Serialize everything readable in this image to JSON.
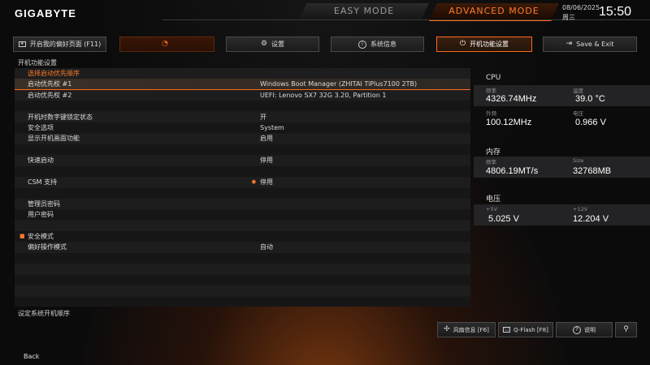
{
  "header": {
    "logo": "GIGABYTE",
    "easy_mode": "EASY MODE",
    "advanced_mode": "ADVANCED MODE",
    "date": "08/06/2025",
    "weekday": "周三",
    "time": "15:50"
  },
  "nav": [
    {
      "label": "开启我的偏好页面 (F11)",
      "icon": "favorites-icon"
    },
    {
      "label": "",
      "icon": "gauge-icon"
    },
    {
      "label": "设置",
      "icon": "gear-icon"
    },
    {
      "label": "系统信息",
      "icon": "info-icon"
    },
    {
      "label": "开机功能设置",
      "icon": "power-icon"
    },
    {
      "label": "Save & Exit",
      "icon": "exit-icon"
    }
  ],
  "section_title": "开机功能设置",
  "settings": [
    {
      "label": "选择启动优先顺序",
      "value": "",
      "type": "group"
    },
    {
      "label": "启动优先权 #1",
      "value": "Windows Boot Manager (ZHITAI TiPlus7100 2TB)",
      "type": "selected"
    },
    {
      "label": "启动优先权 #2",
      "value": "UEFI: Lenovo SX7 32G 3.20, Partition 1",
      "type": "item"
    },
    {
      "label": "",
      "value": "",
      "type": "blank"
    },
    {
      "label": "开机时数字键锁定状态",
      "value": "开",
      "type": "item"
    },
    {
      "label": "安全选项",
      "value": "System",
      "type": "item"
    },
    {
      "label": "显示开机画面功能",
      "value": "启用",
      "type": "item"
    },
    {
      "label": "",
      "value": "",
      "type": "blank"
    },
    {
      "label": "快速启动",
      "value": "停用",
      "type": "item"
    },
    {
      "label": "",
      "value": "",
      "type": "blank"
    },
    {
      "label": "CSM 支持",
      "value": "停用",
      "type": "item",
      "value_bullet": true
    },
    {
      "label": "",
      "value": "",
      "type": "blank"
    },
    {
      "label": "管理员密码",
      "value": "",
      "type": "item"
    },
    {
      "label": "用户密码",
      "value": "",
      "type": "item"
    },
    {
      "label": "",
      "value": "",
      "type": "blank"
    },
    {
      "label": "安全模式",
      "value": "",
      "type": "item",
      "bullet": true
    },
    {
      "label": "偏好操作模式",
      "value": "自动",
      "type": "item"
    }
  ],
  "help_text": "设定系统开机顺序",
  "monitor": {
    "cpu": {
      "title": "CPU",
      "freq_label": "频率",
      "freq": "4326.74MHz",
      "temp_label": "温度",
      "temp": "39.0 °C",
      "ext_label": "外频",
      "ext": "100.12MHz",
      "volt_label": "电压",
      "volt": "0.966 V"
    },
    "memory": {
      "title": "内存",
      "freq_label": "频率",
      "freq": "4806.19MT/s",
      "size_label": "Size",
      "size": "32768MB"
    },
    "voltage": {
      "title": "电压",
      "v5_label": "+5V",
      "v5": "5.025 V",
      "v12_label": "+12V",
      "v12": "12.204 V"
    }
  },
  "bottom": {
    "fan": "风扇信息 [F6]",
    "qflash": "Q-Flash [F8]",
    "help": "说明",
    "back": "Back"
  },
  "colors": {
    "accent": "#ff6a1a"
  }
}
